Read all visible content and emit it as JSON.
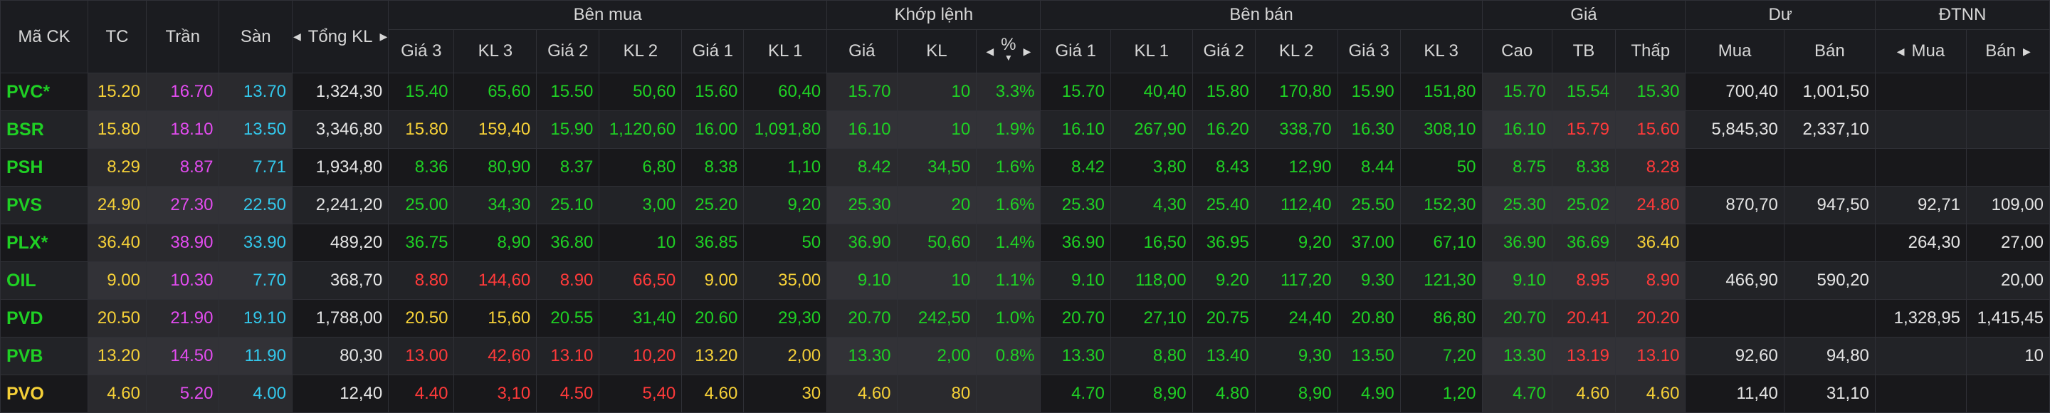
{
  "colors": {
    "up": "#1fd024",
    "down": "#ff3a3a",
    "reference": "#f5d038",
    "ceiling": "#e34cf0",
    "floor": "#33c8ec",
    "neutral": "#e4e4e4",
    "background": "#121214"
  },
  "headers": {
    "symbol": "Mã CK",
    "ref": "TC",
    "ceil": "Trần",
    "floor": "Sàn",
    "total_vol": "Tổng KL",
    "bid_group": "Bên mua",
    "match_group": "Khớp lệnh",
    "ask_group": "Bên bán",
    "price_group": "Giá",
    "remain_group": "Dư",
    "foreign_group": "ĐTNN",
    "bid_cols": [
      "Giá 3",
      "KL 3",
      "Giá 2",
      "KL 2",
      "Giá 1",
      "KL 1"
    ],
    "match_cols": [
      "Giá",
      "KL",
      "%"
    ],
    "ask_cols": [
      "Giá 1",
      "KL 1",
      "Giá 2",
      "KL 2",
      "Giá 3",
      "KL 3"
    ],
    "price_cols": [
      "Cao",
      "TB",
      "Thấp"
    ],
    "remain_cols": [
      "Mua",
      "Bán"
    ],
    "foreign_cols": [
      "Mua",
      "Bán"
    ]
  },
  "rows": [
    {
      "sym": "PVC*",
      "tc": "15.20",
      "ceil": "16.70",
      "floor": "13.70",
      "tot": "1,324,30",
      "bid": [
        [
          "15.40",
          "65,60",
          "up"
        ],
        [
          "15.50",
          "50,60",
          "up"
        ],
        [
          "15.60",
          "60,40",
          "up"
        ]
      ],
      "match": [
        "15.70",
        "10",
        "3.3%",
        "up"
      ],
      "ask": [
        [
          "15.70",
          "40,40",
          "up"
        ],
        [
          "15.80",
          "170,80",
          "up"
        ],
        [
          "15.90",
          "151,80",
          "up"
        ]
      ],
      "hi": [
        "15.70",
        "up"
      ],
      "avg": [
        "15.54",
        "up"
      ],
      "lo": [
        "15.30",
        "up"
      ],
      "rem_buy": "700,40",
      "rem_sell": "1,001,50",
      "f_buy": "",
      "f_sell": ""
    },
    {
      "sym": "BSR",
      "tc": "15.80",
      "ceil": "18.10",
      "floor": "13.50",
      "tot": "3,346,80",
      "bid": [
        [
          "15.80",
          "159,40",
          "ref"
        ],
        [
          "15.90",
          "1,120,60",
          "up"
        ],
        [
          "16.00",
          "1,091,80",
          "up"
        ]
      ],
      "match": [
        "16.10",
        "10",
        "1.9%",
        "up"
      ],
      "ask": [
        [
          "16.10",
          "267,90",
          "up"
        ],
        [
          "16.20",
          "338,70",
          "up"
        ],
        [
          "16.30",
          "308,10",
          "up"
        ]
      ],
      "hi": [
        "16.10",
        "up"
      ],
      "avg": [
        "15.79",
        "down"
      ],
      "lo": [
        "15.60",
        "down"
      ],
      "rem_buy": "5,845,30",
      "rem_sell": "2,337,10",
      "f_buy": "",
      "f_sell": ""
    },
    {
      "sym": "PSH",
      "tc": "8.29",
      "ceil": "8.87",
      "floor": "7.71",
      "tot": "1,934,80",
      "bid": [
        [
          "8.36",
          "80,90",
          "up"
        ],
        [
          "8.37",
          "6,80",
          "up"
        ],
        [
          "8.38",
          "1,10",
          "up"
        ]
      ],
      "match": [
        "8.42",
        "34,50",
        "1.6%",
        "up"
      ],
      "ask": [
        [
          "8.42",
          "3,80",
          "up"
        ],
        [
          "8.43",
          "12,90",
          "up"
        ],
        [
          "8.44",
          "50",
          "up"
        ]
      ],
      "hi": [
        "8.75",
        "up"
      ],
      "avg": [
        "8.38",
        "up"
      ],
      "lo": [
        "8.28",
        "down"
      ],
      "rem_buy": "",
      "rem_sell": "",
      "f_buy": "",
      "f_sell": ""
    },
    {
      "sym": "PVS",
      "tc": "24.90",
      "ceil": "27.30",
      "floor": "22.50",
      "tot": "2,241,20",
      "bid": [
        [
          "25.00",
          "34,30",
          "up"
        ],
        [
          "25.10",
          "3,00",
          "up"
        ],
        [
          "25.20",
          "9,20",
          "up"
        ]
      ],
      "match": [
        "25.30",
        "20",
        "1.6%",
        "up"
      ],
      "ask": [
        [
          "25.30",
          "4,30",
          "up"
        ],
        [
          "25.40",
          "112,40",
          "up"
        ],
        [
          "25.50",
          "152,30",
          "up"
        ]
      ],
      "hi": [
        "25.30",
        "up"
      ],
      "avg": [
        "25.02",
        "up"
      ],
      "lo": [
        "24.80",
        "down"
      ],
      "rem_buy": "870,70",
      "rem_sell": "947,50",
      "f_buy": "92,71",
      "f_sell": "109,00"
    },
    {
      "sym": "PLX*",
      "tc": "36.40",
      "ceil": "38.90",
      "floor": "33.90",
      "tot": "489,20",
      "bid": [
        [
          "36.75",
          "8,90",
          "up"
        ],
        [
          "36.80",
          "10",
          "up"
        ],
        [
          "36.85",
          "50",
          "up"
        ]
      ],
      "match": [
        "36.90",
        "50,60",
        "1.4%",
        "up"
      ],
      "ask": [
        [
          "36.90",
          "16,50",
          "up"
        ],
        [
          "36.95",
          "9,20",
          "up"
        ],
        [
          "37.00",
          "67,10",
          "up"
        ]
      ],
      "hi": [
        "36.90",
        "up"
      ],
      "avg": [
        "36.69",
        "up"
      ],
      "lo": [
        "36.40",
        "ref"
      ],
      "rem_buy": "",
      "rem_sell": "",
      "f_buy": "264,30",
      "f_sell": "27,00"
    },
    {
      "sym": "OIL",
      "tc": "9.00",
      "ceil": "10.30",
      "floor": "7.70",
      "tot": "368,70",
      "bid": [
        [
          "8.80",
          "144,60",
          "down"
        ],
        [
          "8.90",
          "66,50",
          "down"
        ],
        [
          "9.00",
          "35,00",
          "ref"
        ]
      ],
      "match": [
        "9.10",
        "10",
        "1.1%",
        "up"
      ],
      "ask": [
        [
          "9.10",
          "118,00",
          "up"
        ],
        [
          "9.20",
          "117,20",
          "up"
        ],
        [
          "9.30",
          "121,30",
          "up"
        ]
      ],
      "hi": [
        "9.10",
        "up"
      ],
      "avg": [
        "8.95",
        "down"
      ],
      "lo": [
        "8.90",
        "down"
      ],
      "rem_buy": "466,90",
      "rem_sell": "590,20",
      "f_buy": "",
      "f_sell": "20,00"
    },
    {
      "sym": "PVD",
      "tc": "20.50",
      "ceil": "21.90",
      "floor": "19.10",
      "tot": "1,788,00",
      "bid": [
        [
          "20.50",
          "15,60",
          "ref"
        ],
        [
          "20.55",
          "31,40",
          "up"
        ],
        [
          "20.60",
          "29,30",
          "up"
        ]
      ],
      "match": [
        "20.70",
        "242,50",
        "1.0%",
        "up"
      ],
      "ask": [
        [
          "20.70",
          "27,10",
          "up"
        ],
        [
          "20.75",
          "24,40",
          "up"
        ],
        [
          "20.80",
          "86,80",
          "up"
        ]
      ],
      "hi": [
        "20.70",
        "up"
      ],
      "avg": [
        "20.41",
        "down"
      ],
      "lo": [
        "20.20",
        "down"
      ],
      "rem_buy": "",
      "rem_sell": "",
      "f_buy": "1,328,95",
      "f_sell": "1,415,45"
    },
    {
      "sym": "PVB",
      "tc": "13.20",
      "ceil": "14.50",
      "floor": "11.90",
      "tot": "80,30",
      "bid": [
        [
          "13.00",
          "42,60",
          "down"
        ],
        [
          "13.10",
          "10,20",
          "down"
        ],
        [
          "13.20",
          "2,00",
          "ref"
        ]
      ],
      "match": [
        "13.30",
        "2,00",
        "0.8%",
        "up"
      ],
      "ask": [
        [
          "13.30",
          "8,80",
          "up"
        ],
        [
          "13.40",
          "9,30",
          "up"
        ],
        [
          "13.50",
          "7,20",
          "up"
        ]
      ],
      "hi": [
        "13.30",
        "up"
      ],
      "avg": [
        "13.19",
        "down"
      ],
      "lo": [
        "13.10",
        "down"
      ],
      "rem_buy": "92,60",
      "rem_sell": "94,80",
      "f_buy": "",
      "f_sell": "10"
    },
    {
      "sym": "PVO",
      "tc": "4.60",
      "ceil": "5.20",
      "floor": "4.00",
      "tot": "12,40",
      "bid": [
        [
          "4.40",
          "3,10",
          "down"
        ],
        [
          "4.50",
          "5,40",
          "down"
        ],
        [
          "4.60",
          "30",
          "ref"
        ]
      ],
      "match": [
        "4.60",
        "80",
        "",
        "ref"
      ],
      "ask": [
        [
          "4.70",
          "8,90",
          "up"
        ],
        [
          "4.80",
          "8,90",
          "up"
        ],
        [
          "4.90",
          "1,20",
          "up"
        ]
      ],
      "hi": [
        "4.70",
        "up"
      ],
      "avg": [
        "4.60",
        "ref"
      ],
      "lo": [
        "4.60",
        "ref"
      ],
      "rem_buy": "11,40",
      "rem_sell": "31,10",
      "f_buy": "",
      "f_sell": ""
    }
  ]
}
